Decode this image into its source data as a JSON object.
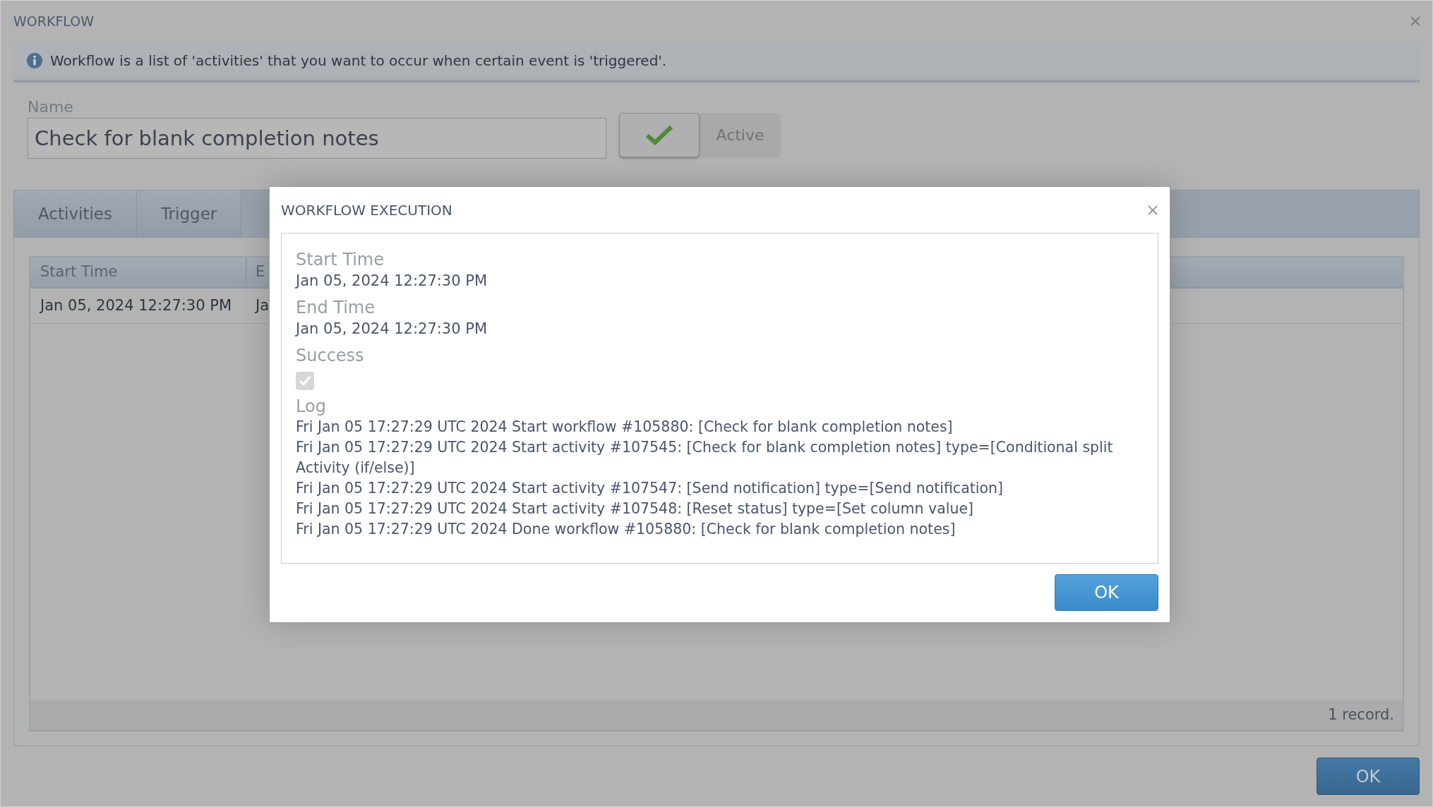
{
  "window": {
    "title": "WORKFLOW"
  },
  "info": "Workflow is a list of 'activities' that you want to occur when certain event is 'triggered'.",
  "form": {
    "name_label": "Name",
    "name_value": "Check for blank completion notes",
    "active": {
      "label": "Active",
      "on": true
    }
  },
  "tabs": [
    {
      "label": "Activities",
      "selected": false
    },
    {
      "label": "Trigger",
      "selected": false
    }
  ],
  "table": {
    "columns": [
      "Start Time",
      "E"
    ],
    "rows": [
      [
        "Jan 05, 2024 12:27:30 PM",
        "Ja"
      ]
    ],
    "footer": "1 record."
  },
  "ok_button": "OK",
  "modal": {
    "title": "WORKFLOW EXECUTION",
    "fields": [
      {
        "kind": "text",
        "label": "Start Time",
        "value": "Jan 05, 2024 12:27:30 PM"
      },
      {
        "kind": "text",
        "label": "End Time",
        "value": "Jan 05, 2024 12:27:30 PM"
      },
      {
        "kind": "checkbox",
        "label": "Success",
        "checked": true,
        "disabled": true
      },
      {
        "kind": "log",
        "label": "Log",
        "lines": [
          "Fri Jan 05 17:27:29 UTC 2024 Start workflow #105880: [Check for blank completion notes]",
          "Fri Jan 05 17:27:29 UTC 2024 Start activity #107545: [Check for blank completion notes] type=[Conditional split Activity (if/else)]",
          "Fri Jan 05 17:27:29 UTC 2024 Start activity #107547: [Send notification] type=[Send notification]",
          "Fri Jan 05 17:27:29 UTC 2024 Start activity #107548: [Reset status] type=[Set column value]",
          "Fri Jan 05 17:27:29 UTC 2024 Done workflow #105880: [Check for blank completion notes]"
        ]
      }
    ],
    "ok_button": "OK"
  }
}
